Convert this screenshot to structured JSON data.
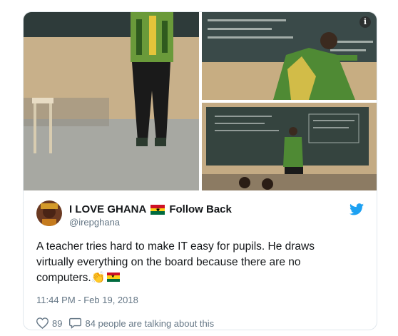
{
  "tweet": {
    "display_name": "I LOVE GHANA",
    "follow_back": "Follow Back",
    "handle": "@irepghana",
    "text_main": "A teacher tries hard to make IT easy for pupils. He draws virtually everything on the board because there are no computers.",
    "timestamp": "11:44 PM - Feb 19, 2018",
    "like_count": "89",
    "talking_text": "84 people are talking about this"
  },
  "media": {
    "photos": [
      "teacher-back-view",
      "teacher-writing-board",
      "teacher-at-board-with-pupils"
    ],
    "info_icon": "i"
  },
  "icons": {
    "flag": "ghana-flag-icon",
    "clap": "clapping-hands-icon",
    "twitter": "twitter-bird-icon",
    "like": "heart-icon",
    "reply": "speech-bubble-icon"
  },
  "colors": {
    "twitter_blue": "#1da1f2",
    "secondary_text": "#657786",
    "border": "#e1e8ed"
  }
}
